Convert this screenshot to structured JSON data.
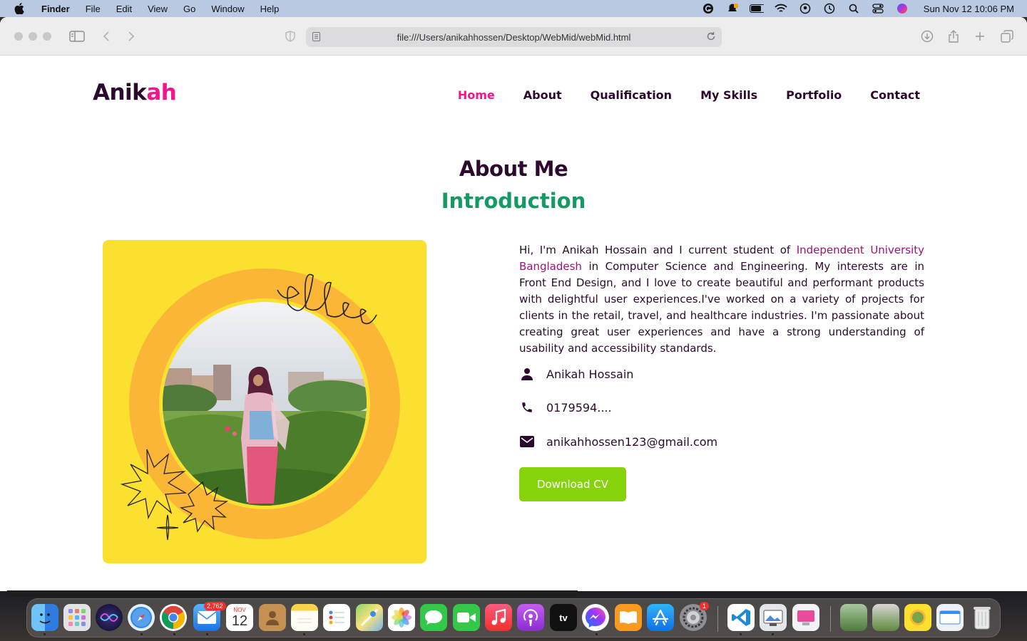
{
  "menubar": {
    "app_name": "Finder",
    "items": [
      "File",
      "Edit",
      "View",
      "Go",
      "Window",
      "Help"
    ],
    "clock": "Sun Nov 12  10:06 PM"
  },
  "browser": {
    "url": "file:///Users/anikahhossen/Desktop/WebMid/webMid.html"
  },
  "site": {
    "logo_main": "Anik",
    "logo_accent": "ah",
    "nav": [
      "Home",
      "About",
      "Qualification",
      "My Skills",
      "Portfolio",
      "Contact"
    ],
    "active_nav": "Home",
    "colors": {
      "accent": "#f4148e",
      "dark": "#2b0a2d",
      "green": "#149a62",
      "button": "#86d30c",
      "card": "#fbe02f"
    }
  },
  "about": {
    "title": "About Me",
    "subtitle": "Introduction",
    "bio_before": "Hi, I'm Anikah Hossain and I current student of ",
    "bio_link": "Independent University Bangladesh",
    "bio_after": " in Computer Science and Engineering. My interests are in Front End Design, and I love to create beautiful and performant products with delightful user experiences.I've worked on a variety of projects for clients in the retail, travel, and healthcare industries. I'm passionate about creating great user experiences and have a strong understanding of usability and accessibility standards.",
    "name": "Anikah Hossain",
    "phone": "0179594....",
    "email": "anikahhossen123@gmail.com",
    "cta": "Download CV"
  },
  "dock": {
    "mail_badge": "2,762",
    "calendar_month": "NOV",
    "calendar_day": "12",
    "settings_badge": "1",
    "tv_label": "tv"
  }
}
